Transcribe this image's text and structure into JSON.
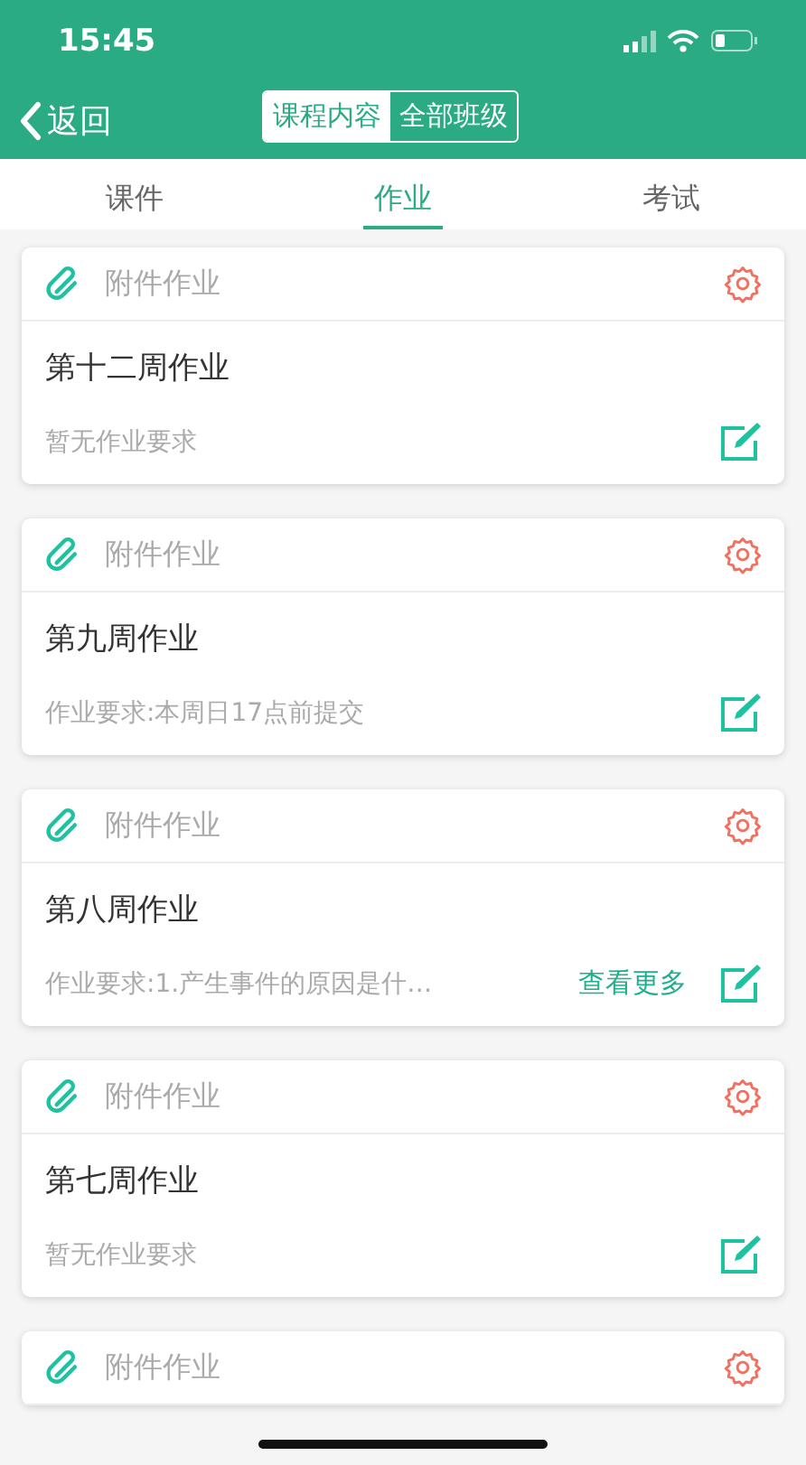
{
  "status_bar": {
    "time": "15:45"
  },
  "nav": {
    "back": "返回",
    "segments": [
      {
        "label": "课程内容",
        "selected": true
      },
      {
        "label": "全部班级",
        "selected": false
      }
    ]
  },
  "tabs": [
    {
      "label": "课件",
      "selected": false
    },
    {
      "label": "作业",
      "selected": true
    },
    {
      "label": "考试",
      "selected": false
    }
  ],
  "assignments": [
    {
      "type": "附件作业",
      "title": "第十二周作业",
      "requirement": "暂无作业要求"
    },
    {
      "type": "附件作业",
      "title": "第九周作业",
      "requirement": "作业要求:本周日17点前提交"
    },
    {
      "type": "附件作业",
      "title": "第八周作业",
      "requirement": "作业要求:1.产生事件的原因是什…",
      "more": "查看更多"
    },
    {
      "type": "附件作业",
      "title": "第七周作业",
      "requirement": "暂无作业要求"
    },
    {
      "type": "附件作业"
    }
  ]
}
